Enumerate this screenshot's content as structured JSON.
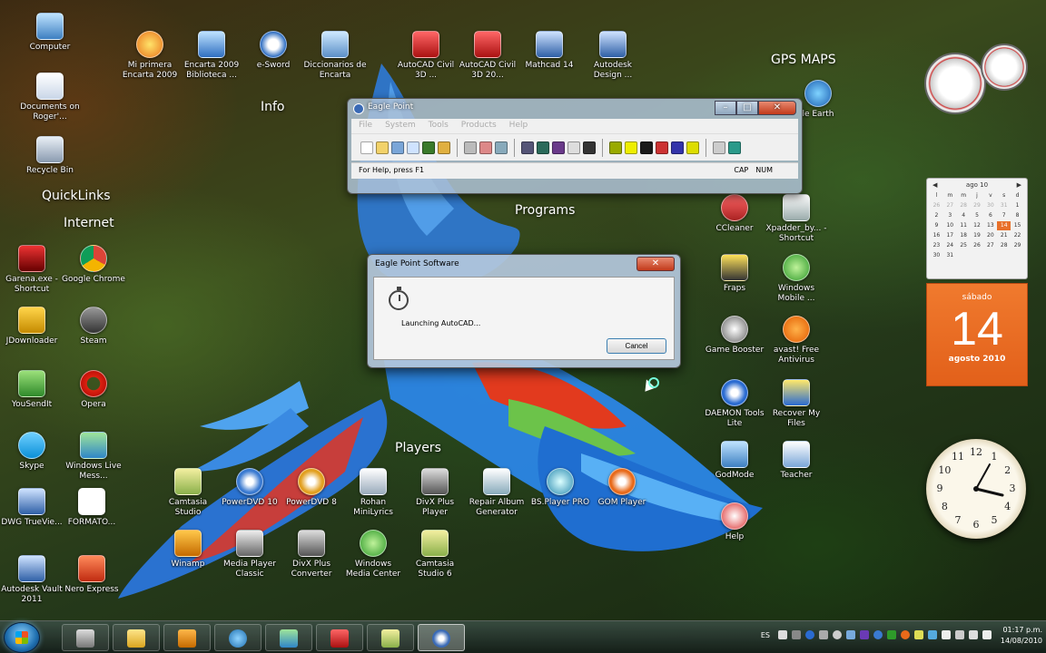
{
  "desktop": {
    "section_labels": {
      "info": "Info",
      "quicklinks": "QuickLinks",
      "internet": "Internet",
      "programs": "Programs",
      "players": "Players",
      "gps_maps": "GPS MAPS"
    },
    "icons": {
      "computer": "Computer",
      "documents": "Documents on Roger'...",
      "recycle_bin": "Recycle Bin",
      "mi_primera_encarta": "Mi primera Encarta 2009",
      "encarta_biblioteca": "Encarta 2009 Biblioteca ...",
      "esword": "e-Sword",
      "diccionarios": "Diccionarios de Encarta",
      "autocad_civil_1": "AutoCAD Civil 3D ...",
      "autocad_civil_2": "AutoCAD Civil 3D 20...",
      "mathcad": "Mathcad 14",
      "autodesk_design": "Autodesk Design ...",
      "google_earth": "le Earth",
      "garena": "Garena.exe - Shortcut",
      "chrome": "Google Chrome",
      "jdownloader": "JDownloader",
      "steam": "Steam",
      "yousendit": "YouSendIt",
      "opera": "Opera",
      "skype": "Skype",
      "windows_live": "Windows Live Mess...",
      "dwg_trueview": "DWG TrueVie...",
      "formato": "FORMATO...",
      "autodesk_vault": "Autodesk Vault 2011",
      "nero": "Nero Express",
      "ccleaner": "CCleaner",
      "xpadder": "Xpadder_by... - Shortcut",
      "fraps": "Fraps",
      "windows_mobile": "Windows Mobile ...",
      "game_booster": "Game Booster",
      "avast": "avast! Free Antivirus",
      "daemon": "DAEMON Tools Lite",
      "recover": "Recover My Files",
      "godmode": "GodMode",
      "teacher": "Teacher",
      "help": "Help",
      "camtasia_studio": "Camtasia Studio",
      "powerdvd10": "PowerDVD 10",
      "powerdvd8": "PowerDVD 8",
      "minilyrics": "Rohan MiniLyrics",
      "divx_player": "DivX Plus Player",
      "repair_album": "Repair Album Generator",
      "bsplayer": "BS.Player PRO",
      "gom": "GOM Player",
      "winamp": "Winamp",
      "media_player_classic": "Media Player Classic",
      "divx_converter": "DivX Plus Converter",
      "windows_media_center": "Windows Media Center",
      "camtasia_studio2": "Camtasia Studio 6"
    }
  },
  "eagle_point": {
    "title": "Eagle Point",
    "menu": [
      "File",
      "System",
      "Tools",
      "Products",
      "Help"
    ],
    "status_left": "For Help, press F1",
    "status_cap": "CAP",
    "status_num": "NUM"
  },
  "dialog": {
    "title": "Eagle Point Software",
    "message": "Launching AutoCAD...",
    "cancel_label": "Cancel"
  },
  "calendar": {
    "month_year": "ago 10",
    "weekday_headers": [
      "l",
      "m",
      "m",
      "j",
      "v",
      "s",
      "d"
    ],
    "dow": "sábado",
    "day": "14",
    "month_label": "agosto 2010"
  },
  "clock_numbers": [
    "12",
    "1",
    "2",
    "3",
    "4",
    "5",
    "6",
    "7",
    "8",
    "9",
    "10",
    "11"
  ],
  "taskbar": {
    "language": "ES",
    "time": "01:17 p.m.",
    "date": "14/08/2010"
  },
  "colors": {
    "calendar_accent": "#e8702a",
    "close_button": "#c23a1b"
  }
}
